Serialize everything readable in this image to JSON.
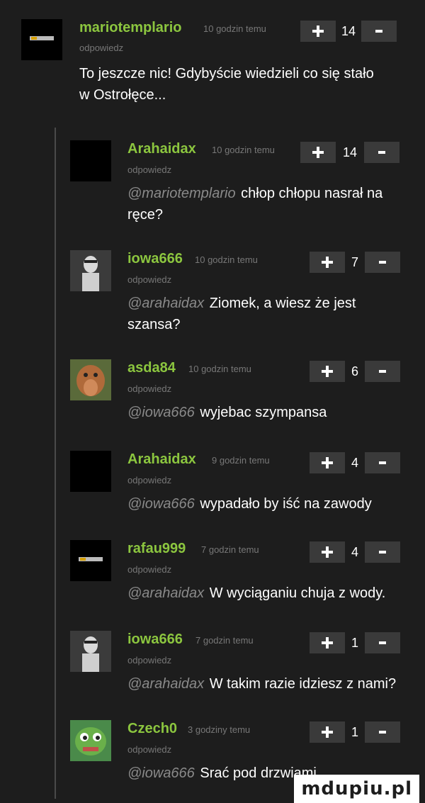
{
  "reply_label": "odpowiedz",
  "comments": [
    {
      "username": "mariotemplario",
      "time": "10 godzin temu",
      "score": "14",
      "mention": "",
      "text": "To jeszcze nic! Gdybyście wiedzieli co się stało w Ostrołęce...",
      "avatar": "logo"
    },
    {
      "username": "Arahaidax",
      "time": "10 godzin temu",
      "score": "14",
      "mention": "@mariotemplario",
      "text": "chłop chłopu nasrał na ręce?",
      "avatar": "black"
    },
    {
      "username": "iowa666",
      "time": "10 godzin temu",
      "score": "7",
      "mention": "@arahaidax",
      "text": "Ziomek, a wiesz że jest szansa?",
      "avatar": "figure"
    },
    {
      "username": "asda84",
      "time": "10 godzin temu",
      "score": "6",
      "mention": "@iowa666",
      "text": "wyjebac szympansa",
      "avatar": "monkey"
    },
    {
      "username": "Arahaidax",
      "time": "9 godzin temu",
      "score": "4",
      "mention": "@iowa666",
      "text": "wypadało by iść na zawody",
      "avatar": "black"
    },
    {
      "username": "rafau999",
      "time": "7 godzin temu",
      "score": "4",
      "mention": "@arahaidax",
      "text": "W wyciąganiu chuja z wody.",
      "avatar": "logo"
    },
    {
      "username": "iowa666",
      "time": "7 godzin temu",
      "score": "1",
      "mention": "@arahaidax",
      "text": "W takim razie idziesz z nami?",
      "avatar": "figure"
    },
    {
      "username": "Czech0",
      "time": "3 godziny temu",
      "score": "1",
      "mention": "@iowa666",
      "text": "Srać pod drzwiami",
      "avatar": "pepe"
    }
  ],
  "watermark": "mdupiu.pl"
}
